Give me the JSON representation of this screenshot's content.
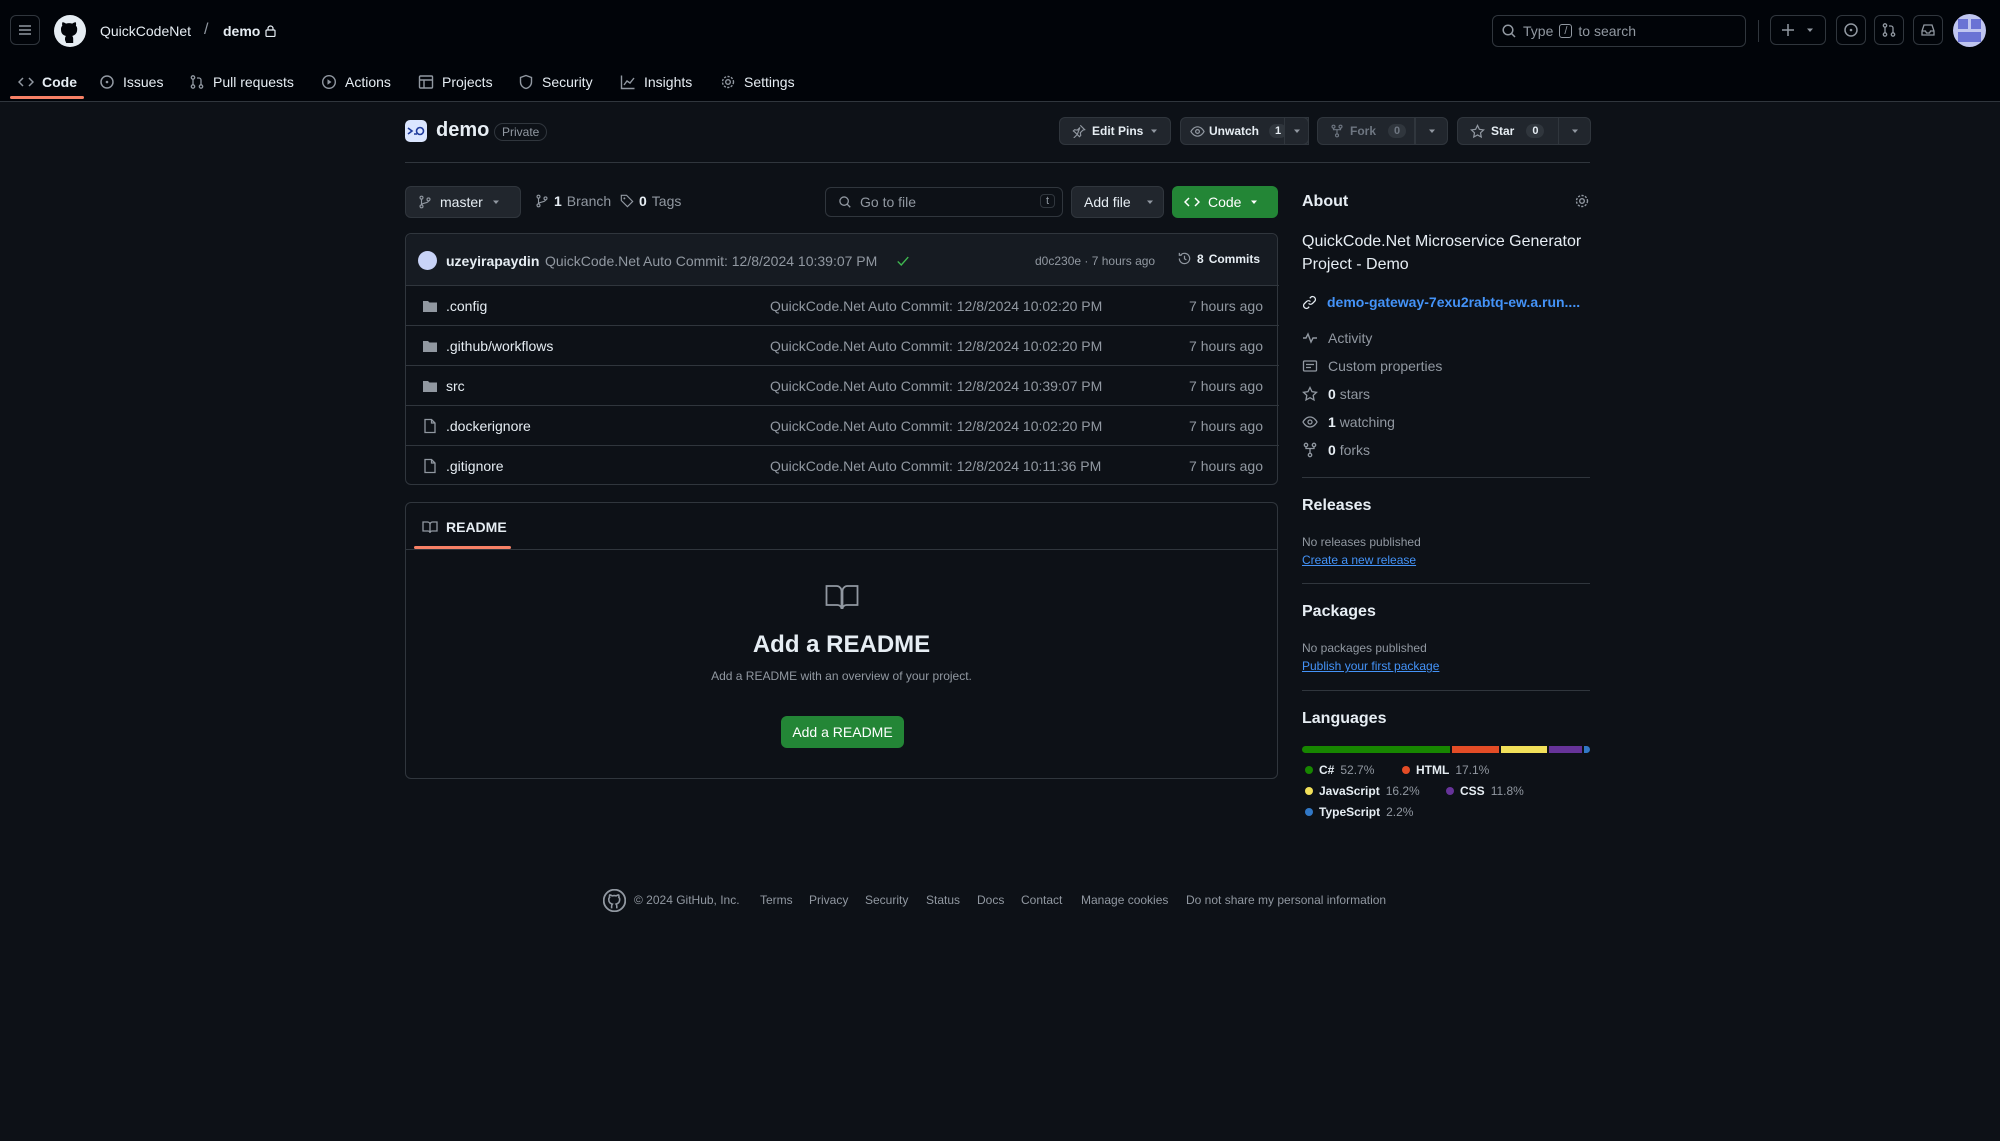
{
  "header": {
    "owner": "QuickCodeNet",
    "separator": "/",
    "repo": "demo",
    "search_type": "Type",
    "search_key": "/",
    "search_suffix": "to search"
  },
  "tabs": [
    {
      "label": "Code",
      "icon": "code-icon",
      "active": true
    },
    {
      "label": "Issues",
      "icon": "issue-opened-icon"
    },
    {
      "label": "Pull requests",
      "icon": "git-pull-request-icon"
    },
    {
      "label": "Actions",
      "icon": "play-icon"
    },
    {
      "label": "Projects",
      "icon": "table-icon"
    },
    {
      "label": "Security",
      "icon": "shield-icon"
    },
    {
      "label": "Insights",
      "icon": "graph-icon"
    },
    {
      "label": "Settings",
      "icon": "gear-icon"
    }
  ],
  "repo": {
    "name": "demo",
    "visibility": "Private",
    "edit_pins": "Edit Pins",
    "unwatch": "Unwatch",
    "unwatch_count": "1",
    "fork": "Fork",
    "fork_count": "0",
    "star": "Star",
    "star_count": "0"
  },
  "toolbar": {
    "branch": "master",
    "branches_count": "1",
    "branches_label": "Branch",
    "tags_count": "0",
    "tags_label": "Tags",
    "go_to_file": "Go to file",
    "go_to_file_key": "t",
    "add_file": "Add file",
    "code": "Code"
  },
  "commit": {
    "author": "uzeyirapaydin",
    "message": "QuickCode.Net Auto Commit: 12/8/2024 10:39:07 PM",
    "sha_age": "d0c230e · 7 hours ago",
    "commits_count": "8",
    "commits_label": "Commits"
  },
  "files": [
    {
      "name": ".config",
      "type": "folder",
      "message": "QuickCode.Net Auto Commit: 12/8/2024 10:02:20 PM",
      "age": "7 hours ago"
    },
    {
      "name": ".github/workflows",
      "type": "folder",
      "message": "QuickCode.Net Auto Commit: 12/8/2024 10:02:20 PM",
      "age": "7 hours ago"
    },
    {
      "name": "src",
      "type": "folder",
      "message": "QuickCode.Net Auto Commit: 12/8/2024 10:39:07 PM",
      "age": "7 hours ago"
    },
    {
      "name": ".dockerignore",
      "type": "file",
      "message": "QuickCode.Net Auto Commit: 12/8/2024 10:02:20 PM",
      "age": "7 hours ago"
    },
    {
      "name": ".gitignore",
      "type": "file",
      "message": "QuickCode.Net Auto Commit: 12/8/2024 10:11:36 PM",
      "age": "7 hours ago"
    }
  ],
  "readme": {
    "tab": "README",
    "title": "Add a README",
    "subtitle": "Add a README with an overview of your project.",
    "button": "Add a README"
  },
  "about": {
    "heading": "About",
    "description": "QuickCode.Net Microservice Generator Project - Demo",
    "link": "demo-gateway-7exu2rabtq-ew.a.run....",
    "activity": "Activity",
    "custom_properties": "Custom properties",
    "stars_count": "0",
    "stars_label": "stars",
    "watching_count": "1",
    "watching_label": "watching",
    "forks_count": "0",
    "forks_label": "forks"
  },
  "releases": {
    "heading": "Releases",
    "none": "No releases published",
    "link": "Create a new release"
  },
  "packages": {
    "heading": "Packages",
    "none": "No packages published",
    "link": "Publish your first package"
  },
  "languages": {
    "heading": "Languages",
    "items": [
      {
        "name": "C#",
        "percent": "52.7%",
        "value": 52.7,
        "color": "#178600"
      },
      {
        "name": "HTML",
        "percent": "17.1%",
        "value": 17.1,
        "color": "#e34c26"
      },
      {
        "name": "JavaScript",
        "percent": "16.2%",
        "value": 16.2,
        "color": "#f1e05a"
      },
      {
        "name": "CSS",
        "percent": "11.8%",
        "value": 11.8,
        "color": "#663399"
      },
      {
        "name": "TypeScript",
        "percent": "2.2%",
        "value": 2.2,
        "color": "#3178c6"
      }
    ]
  },
  "footer": {
    "copyright": "© 2024 GitHub, Inc.",
    "links": [
      "Terms",
      "Privacy",
      "Security",
      "Status",
      "Docs",
      "Contact",
      "Manage cookies",
      "Do not share my personal information"
    ]
  }
}
